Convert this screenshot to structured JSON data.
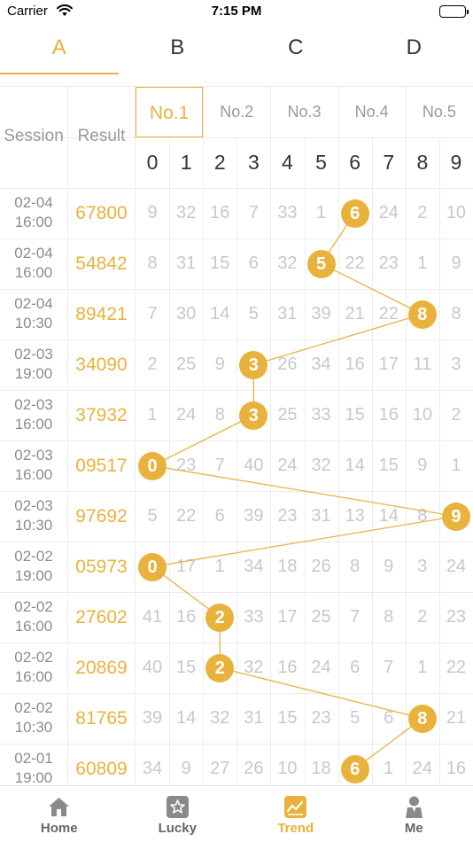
{
  "status_bar": {
    "carrier": "Carrier",
    "time": "7:15 PM"
  },
  "tabs": [
    {
      "label": "A",
      "active": true
    },
    {
      "label": "B",
      "active": false
    },
    {
      "label": "C",
      "active": false
    },
    {
      "label": "D",
      "active": false
    }
  ],
  "table": {
    "session_header": "Session",
    "result_header": "Result",
    "positions": [
      "No.1",
      "No.2",
      "No.3",
      "No.4",
      "No.5"
    ],
    "active_position": 0,
    "digits": [
      "0",
      "1",
      "2",
      "3",
      "4",
      "5",
      "6",
      "7",
      "8",
      "9"
    ],
    "rows": [
      {
        "date": "02-04",
        "time": "16:00",
        "result": "67800",
        "hit": 6,
        "values": [
          9,
          32,
          16,
          7,
          33,
          1,
          6,
          24,
          2,
          10
        ]
      },
      {
        "date": "02-04",
        "time": "16:00",
        "result": "54842",
        "hit": 5,
        "values": [
          8,
          31,
          15,
          6,
          32,
          5,
          22,
          23,
          1,
          9
        ]
      },
      {
        "date": "02-04",
        "time": "10:30",
        "result": "89421",
        "hit": 8,
        "values": [
          7,
          30,
          14,
          5,
          31,
          39,
          21,
          22,
          8,
          8
        ]
      },
      {
        "date": "02-03",
        "time": "19:00",
        "result": "34090",
        "hit": 3,
        "values": [
          2,
          25,
          9,
          3,
          26,
          34,
          16,
          17,
          11,
          3
        ]
      },
      {
        "date": "02-03",
        "time": "16:00",
        "result": "37932",
        "hit": 3,
        "values": [
          1,
          24,
          8,
          3,
          25,
          33,
          15,
          16,
          10,
          2
        ]
      },
      {
        "date": "02-03",
        "time": "16:00",
        "result": "09517",
        "hit": 0,
        "values": [
          0,
          23,
          7,
          40,
          24,
          32,
          14,
          15,
          9,
          1
        ]
      },
      {
        "date": "02-03",
        "time": "10:30",
        "result": "97692",
        "hit": 9,
        "values": [
          5,
          22,
          6,
          39,
          23,
          31,
          13,
          14,
          8,
          9
        ]
      },
      {
        "date": "02-02",
        "time": "19:00",
        "result": "05973",
        "hit": 0,
        "values": [
          0,
          17,
          1,
          34,
          18,
          26,
          8,
          9,
          3,
          24
        ]
      },
      {
        "date": "02-02",
        "time": "16:00",
        "result": "27602",
        "hit": 2,
        "values": [
          41,
          16,
          2,
          33,
          17,
          25,
          7,
          8,
          2,
          23
        ]
      },
      {
        "date": "02-02",
        "time": "16:00",
        "result": "20869",
        "hit": 2,
        "values": [
          40,
          15,
          2,
          32,
          16,
          24,
          6,
          7,
          1,
          22
        ]
      },
      {
        "date": "02-02",
        "time": "10:30",
        "result": "81765",
        "hit": 8,
        "values": [
          39,
          14,
          32,
          31,
          15,
          23,
          5,
          6,
          8,
          21
        ]
      },
      {
        "date": "02-01",
        "time": "19:00",
        "result": "60809",
        "hit": 6,
        "values": [
          34,
          9,
          27,
          26,
          10,
          18,
          6,
          1,
          24,
          16
        ]
      }
    ]
  },
  "bottom_nav": [
    {
      "label": "Home",
      "icon": "home-icon",
      "active": false
    },
    {
      "label": "Lucky",
      "icon": "star-icon",
      "active": false
    },
    {
      "label": "Trend",
      "icon": "trend-chart-icon",
      "active": true
    },
    {
      "label": "Me",
      "icon": "person-icon",
      "active": false
    }
  ],
  "colors": {
    "accent": "#e9b23c",
    "muted_text": "#c8c8c8",
    "header_text": "#9a9a9a",
    "grid": "#ececec"
  }
}
